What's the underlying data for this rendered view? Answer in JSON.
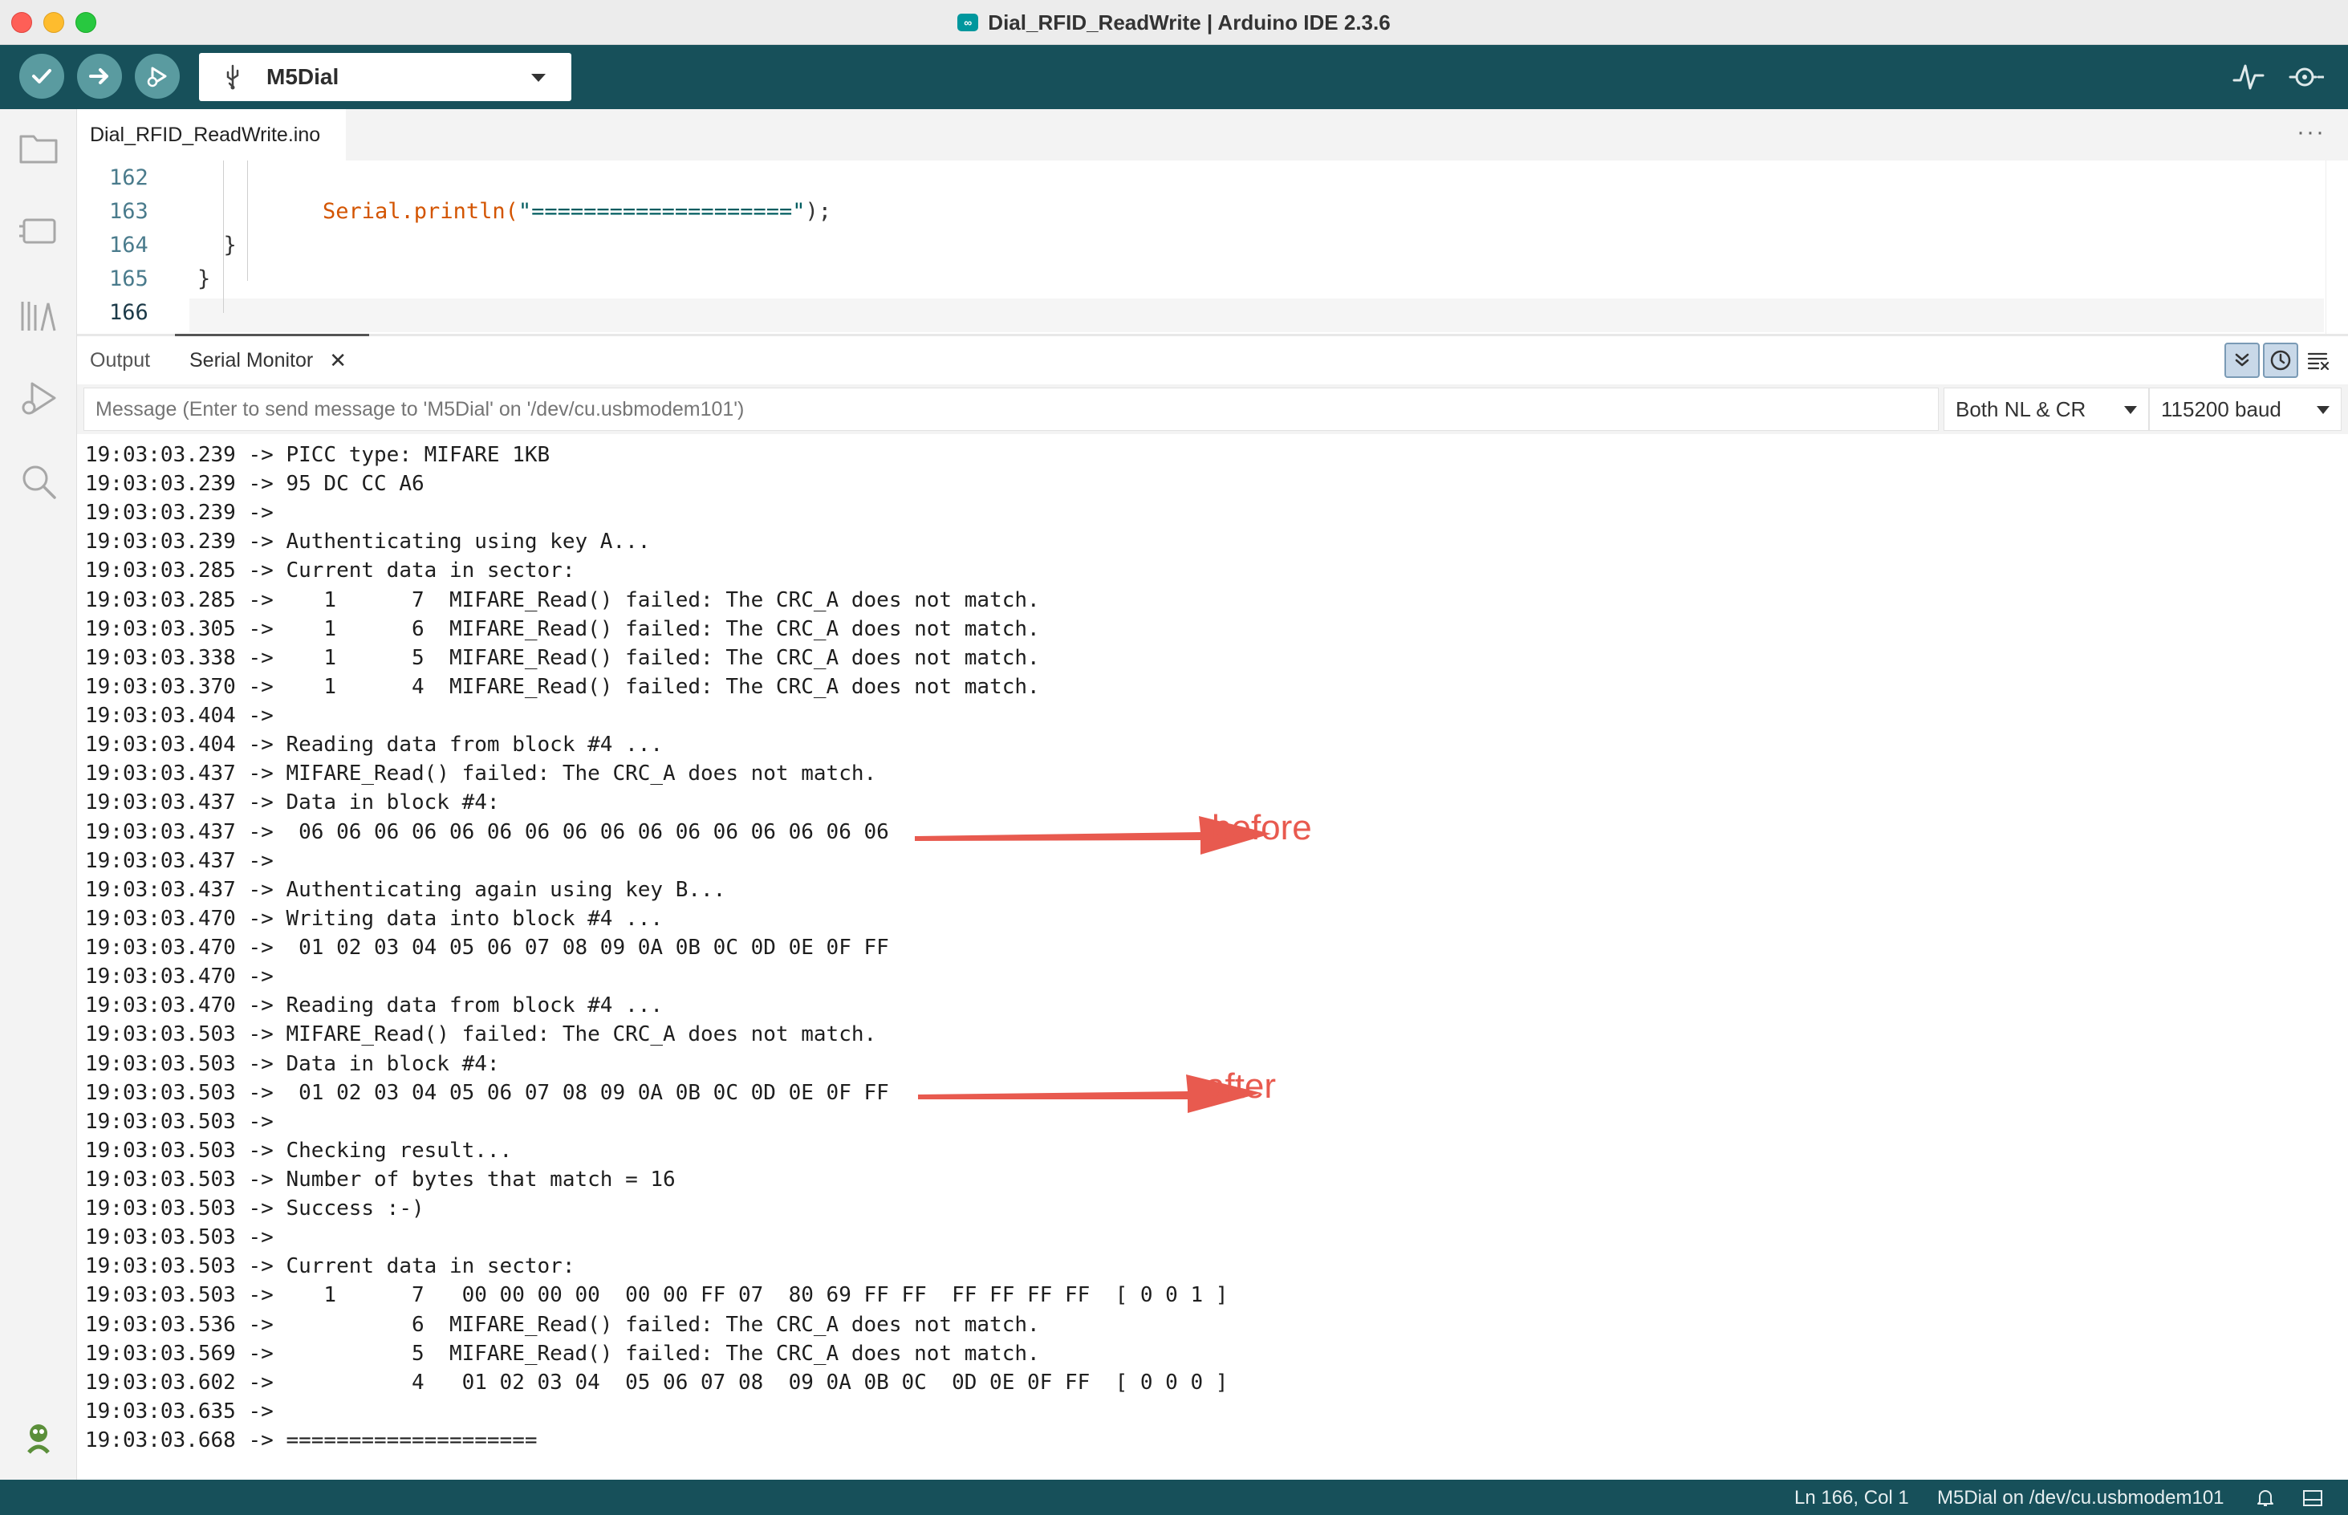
{
  "window": {
    "title": "Dial_RFID_ReadWrite | Arduino IDE 2.3.6"
  },
  "toolbar": {
    "board": "M5Dial"
  },
  "editor": {
    "tab": "Dial_RFID_ReadWrite.ino",
    "lines": [
      {
        "num": "162",
        "code": ""
      },
      {
        "num": "163",
        "code": "    Serial.println(\"====================\");"
      },
      {
        "num": "164",
        "code": "  }"
      },
      {
        "num": "165",
        "code": "}"
      },
      {
        "num": "166",
        "code": ""
      }
    ],
    "code_line_163": {
      "obj": "Serial",
      "method": ".println(",
      "string": "\"====================\"",
      "tail": ");"
    }
  },
  "panel": {
    "tabs": {
      "output": "Output",
      "serial": "Serial Monitor"
    },
    "message_placeholder": "Message (Enter to send message to 'M5Dial' on '/dev/cu.usbmodem101')",
    "line_ending": "Both NL & CR",
    "baud": "115200 baud"
  },
  "serial_lines": [
    "19:03:03.239 -> PICC type: MIFARE 1KB",
    "19:03:03.239 -> 95 DC CC A6",
    "19:03:03.239 -> ",
    "19:03:03.239 -> Authenticating using key A...",
    "19:03:03.285 -> Current data in sector:",
    "19:03:03.285 ->    1      7  MIFARE_Read() failed: The CRC_A does not match.",
    "19:03:03.305 ->    1      6  MIFARE_Read() failed: The CRC_A does not match.",
    "19:03:03.338 ->    1      5  MIFARE_Read() failed: The CRC_A does not match.",
    "19:03:03.370 ->    1      4  MIFARE_Read() failed: The CRC_A does not match.",
    "19:03:03.404 -> ",
    "19:03:03.404 -> Reading data from block #4 ...",
    "19:03:03.437 -> MIFARE_Read() failed: The CRC_A does not match.",
    "19:03:03.437 -> Data in block #4:",
    "19:03:03.437 ->  06 06 06 06 06 06 06 06 06 06 06 06 06 06 06 06",
    "19:03:03.437 -> ",
    "19:03:03.437 -> Authenticating again using key B...",
    "19:03:03.470 -> Writing data into block #4 ...",
    "19:03:03.470 ->  01 02 03 04 05 06 07 08 09 0A 0B 0C 0D 0E 0F FF",
    "19:03:03.470 -> ",
    "19:03:03.470 -> Reading data from block #4 ...",
    "19:03:03.503 -> MIFARE_Read() failed: The CRC_A does not match.",
    "19:03:03.503 -> Data in block #4:",
    "19:03:03.503 ->  01 02 03 04 05 06 07 08 09 0A 0B 0C 0D 0E 0F FF",
    "19:03:03.503 -> ",
    "19:03:03.503 -> Checking result...",
    "19:03:03.503 -> Number of bytes that match = 16",
    "19:03:03.503 -> Success :-)",
    "19:03:03.503 -> ",
    "19:03:03.503 -> Current data in sector:",
    "19:03:03.503 ->    1      7   00 00 00 00  00 00 FF 07  80 69 FF FF  FF FF FF FF  [ 0 0 1 ]",
    "19:03:03.536 ->           6  MIFARE_Read() failed: The CRC_A does not match.",
    "19:03:03.569 ->           5  MIFARE_Read() failed: The CRC_A does not match.",
    "19:03:03.602 ->           4   01 02 03 04  05 06 07 08  09 0A 0B 0C  0D 0E 0F FF  [ 0 0 0 ]",
    "19:03:03.635 -> ",
    "19:03:03.668 -> ===================="
  ],
  "annotations": {
    "before": "before",
    "after": "after",
    "color": "#e85a4f"
  },
  "status": {
    "position": "Ln 166, Col 1",
    "board_port": "M5Dial on /dev/cu.usbmodem101"
  },
  "colors": {
    "toolbar": "#17505a",
    "button": "#5a9ba0",
    "keyword": "#d35400",
    "string": "#005c5f"
  }
}
